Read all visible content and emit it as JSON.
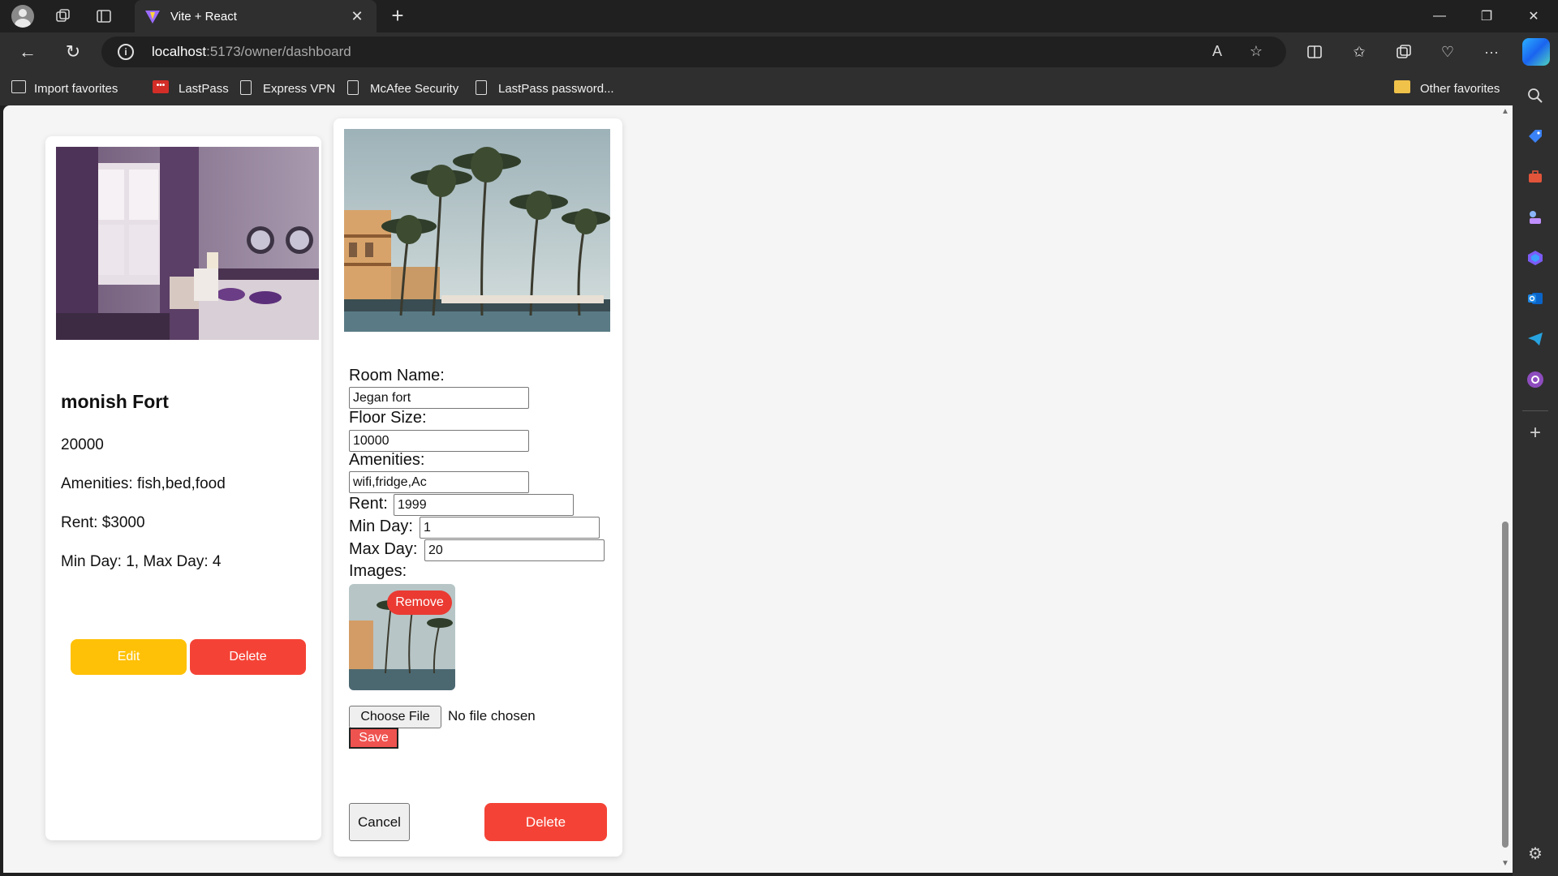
{
  "browser": {
    "tab_title": "Vite + React",
    "url_host": "localhost",
    "url_path": ":5173/owner/dashboard",
    "favorites": [
      {
        "label": "Import favorites",
        "icon": "import-favorites-icon"
      },
      {
        "label": "LastPass",
        "icon": "lastpass-icon"
      },
      {
        "label": "Express VPN",
        "icon": "page-icon"
      },
      {
        "label": "McAfee Security",
        "icon": "page-icon"
      },
      {
        "label": "LastPass password...",
        "icon": "page-icon"
      }
    ],
    "other_favorites": "Other favorites"
  },
  "room_card": {
    "name": "monish Fort",
    "price": "20000",
    "amenities": "Amenities: fish,bed,food",
    "rent": "Rent: $3000",
    "days": "Min Day: 1, Max Day: 4",
    "edit_label": "Edit",
    "delete_label": "Delete"
  },
  "edit_form": {
    "room_name_label": "Room Name:",
    "room_name_value": "Jegan fort",
    "floor_size_label": "Floor Size:",
    "floor_size_value": "10000",
    "amenities_label": "Amenities:",
    "amenities_value": "wifi,fridge,Ac",
    "rent_label": "Rent:",
    "rent_value": "1999",
    "min_day_label": "Min Day:",
    "min_day_value": "1",
    "max_day_label": "Max Day:",
    "max_day_value": "20",
    "images_label": "Images:",
    "remove_label": "Remove",
    "choose_file_label": "Choose File",
    "no_file_text": "No file chosen",
    "save_label": "Save",
    "cancel_label": "Cancel",
    "delete_label": "Delete"
  },
  "colors": {
    "edit_button": "#ffc107",
    "delete_button": "#f44336",
    "save_button": "#ef5350"
  }
}
